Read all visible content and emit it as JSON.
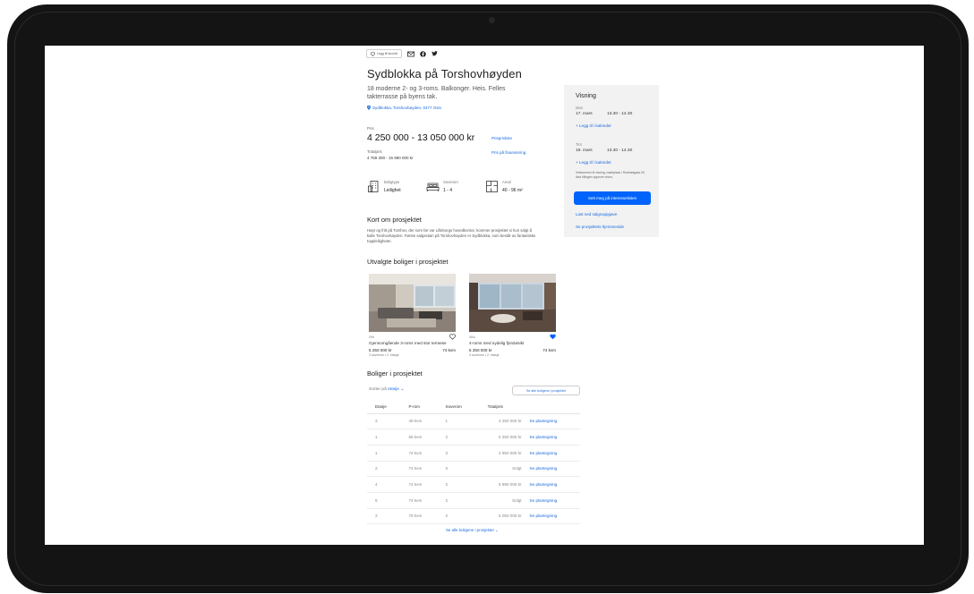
{
  "share": {
    "favorite_label": "Legg til favoritt",
    "icons": [
      "heart-icon",
      "mail-icon",
      "facebook-icon",
      "twitter-icon"
    ]
  },
  "project": {
    "title": "Sydblokka på Torshovhøyden",
    "subtitle": "18 moderne 2- og 3-roms. Balkonger. Heis. Felles takterrasse på byens tak.",
    "address": "Sydblokka, Torshovhøyden, 0477 Oslo"
  },
  "price": {
    "label": "Pris",
    "value": "4 250 000 - 13 050 000 kr",
    "link": "Prisprisliste",
    "total_label": "Totalpris",
    "total_value": "4 769 300 - 15 990 000 kr",
    "debt_link": "Pris på finansiering"
  },
  "facts": [
    {
      "icon": "building-icon",
      "label": "Boligtype",
      "value": "Leilighet"
    },
    {
      "icon": "bed-icon",
      "label": "Soverom",
      "value": "1 - 4"
    },
    {
      "icon": "floorplan-icon",
      "label": "Areal",
      "value": "40 - 96 m²"
    }
  ],
  "about": {
    "heading": "Kort om prosjektet",
    "text": "Høyt og fritt på Torshov, der som før var Lilleborgs hovedkontor, kommer prosjektet si hun salgt å kalle Torshovhøyden. Første salgsetain på Torshovhøyden er Sydblokka, som består av fantastiske toppleiligheter."
  },
  "selected": {
    "heading": "Utvalgte boliger i prosjektet",
    "cards": [
      {
        "floor": "2fllt",
        "name": "Gjennomgående 3-roms med stor terrasse",
        "price": "5 250 000 kr",
        "area": "74 kvm",
        "meta": "3 soverom • 2. etasje",
        "favorited": false
      },
      {
        "floor": "4fllu",
        "name": "4-roms med nydelig fjordutsikt",
        "price": "5 250 000 kr",
        "area": "74 kvm",
        "meta": "3 soverom • 2. etasje",
        "favorited": true
      }
    ]
  },
  "units": {
    "heading": "Boliger i prosjektet",
    "sort_prefix": "Sorter på",
    "sort_value": "etasje",
    "all_button": "Se alle boligene i prosjektet",
    "columns": [
      "Etasje",
      "P-rom",
      "Soverom",
      "Totalpris",
      ""
    ],
    "rows": [
      [
        "3",
        "49 kvm",
        "1",
        "4 250 000 kr",
        "Se plantegning"
      ],
      [
        "1",
        "66 kvm",
        "2",
        "5 250 000 kr",
        "Se plantegning"
      ],
      [
        "1",
        "74 kvm",
        "3",
        "4 950 000 kr",
        "Se plantegning"
      ],
      [
        "2",
        "74 kvm",
        "3",
        "Solgt",
        "Se plantegning"
      ],
      [
        "4",
        "74 kvm",
        "2",
        "5 890 000 kr",
        "Se plantegning"
      ],
      [
        "5",
        "74 kvm",
        "2",
        "Solgt",
        "Se plantegning"
      ],
      [
        "3",
        "78 kvm",
        "2",
        "6 050 000 kr",
        "Se plantegning"
      ]
    ],
    "more_link": "Se alle boligene i prosjektet"
  },
  "viewing": {
    "title": "Visning",
    "slots": [
      {
        "day": "Man",
        "date": "17. mars",
        "time": "13.30 - 14.30",
        "cal": "+ Legg til i kalender"
      },
      {
        "day": "Tirs",
        "date": "18. mars",
        "time": "13.30 - 14.30",
        "cal": "+ Legg til i kalender"
      }
    ],
    "note": "Velkommen til visning, møteplass i Rodeløkgata 00. Ikke tillingen oppover visen.",
    "button": "Sett meg på interesselisten",
    "download": "Last ned salgsoppgave",
    "homepage": "Se prosjektets hjemmeside"
  },
  "colors": {
    "accent": "#0063fb",
    "link": "#1a6be0"
  }
}
